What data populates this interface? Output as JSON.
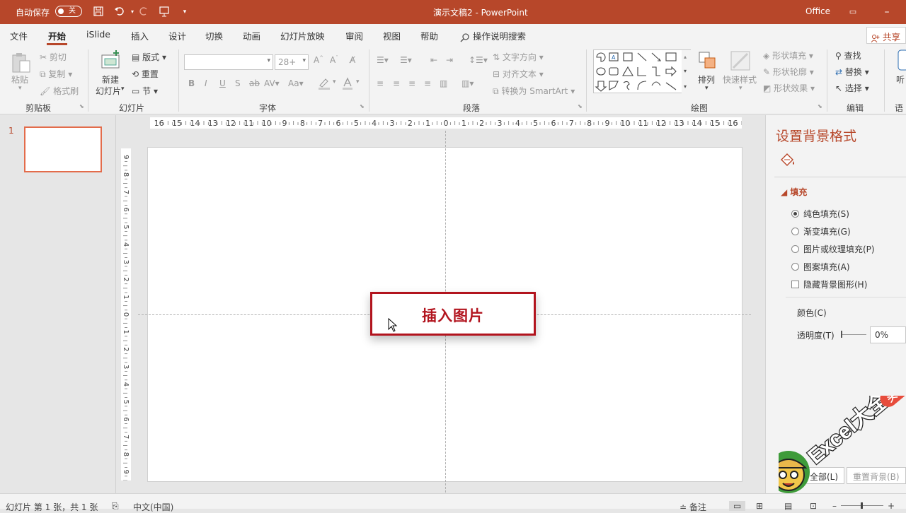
{
  "titlebar": {
    "autosave_label": "自动保存",
    "autosave_state": "关",
    "doc_title": "演示文稿2  -  PowerPoint",
    "account": "Office"
  },
  "tabs": [
    "文件",
    "开始",
    "iSlide",
    "插入",
    "设计",
    "切换",
    "动画",
    "幻灯片放映",
    "审阅",
    "视图",
    "帮助"
  ],
  "active_tab": "开始",
  "tell_me": "操作说明搜索",
  "share": "共享",
  "ribbon": {
    "clipboard": {
      "paste": "粘贴",
      "cut": "剪切",
      "copy": "复制",
      "format_painter": "格式刷",
      "label": "剪贴板"
    },
    "slides": {
      "new_slide_line1": "新建",
      "new_slide_line2": "幻灯片",
      "layout": "版式",
      "reset": "重置",
      "section": "节",
      "label": "幻灯片"
    },
    "font": {
      "font_name": "",
      "font_size": "28+",
      "bold": "B",
      "italic": "I",
      "underline": "U",
      "shadow": "S",
      "strike": "ab",
      "spacing": "AV",
      "case": "Aa",
      "label": "字体"
    },
    "paragraph": {
      "text_direction": "文字方向",
      "align_text": "对齐文本",
      "smartart": "转换为 SmartArt",
      "label": "段落"
    },
    "drawing": {
      "arrange": "排列",
      "quick_styles": "快速样式",
      "shape_fill": "形状填充",
      "shape_outline": "形状轮廓",
      "shape_effects": "形状效果",
      "label": "绘图"
    },
    "editing": {
      "find": "查找",
      "replace": "替换",
      "select": "选择",
      "label": "编辑"
    },
    "voice": {
      "listen": "听",
      "label": "语"
    }
  },
  "thumbs": {
    "number": "1"
  },
  "ruler": {
    "h_ticks": [
      "16",
      "15",
      "14",
      "13",
      "12",
      "11",
      "10",
      "9",
      "8",
      "7",
      "6",
      "5",
      "4",
      "3",
      "2",
      "1",
      "0",
      "1",
      "2",
      "3",
      "4",
      "5",
      "6",
      "7",
      "8",
      "9",
      "10",
      "11",
      "12",
      "13",
      "14",
      "15",
      "16"
    ],
    "v_ticks": [
      "9",
      "8",
      "7",
      "6",
      "5",
      "4",
      "3",
      "2",
      "1",
      "0",
      "1",
      "2",
      "3",
      "4",
      "5",
      "6",
      "7",
      "8",
      "9"
    ]
  },
  "callout": {
    "text": "插入图片"
  },
  "pane": {
    "title": "设置背景格式",
    "section": "填充",
    "options": [
      "纯色填充(S)",
      "渐变填充(G)",
      "图片或纹理填充(P)",
      "图案填充(A)"
    ],
    "selected_option": 0,
    "hide_bg": "隐藏背景图形(H)",
    "color_label": "颜色(C)",
    "transparency_label": "透明度(T)",
    "transparency_value": "0%",
    "apply_all": "全部(L)",
    "reset_bg": "重置背景(B)"
  },
  "status": {
    "slide_info": "幻灯片 第 1 张，共 1 张",
    "language": "中文(中国)",
    "notes": "备注"
  },
  "watermark": {
    "text": "Excel大全",
    "badge": "头条号"
  },
  "colors": {
    "accent": "#b7472a",
    "callout": "#b2141e",
    "thumb_border": "#e36c4b"
  }
}
